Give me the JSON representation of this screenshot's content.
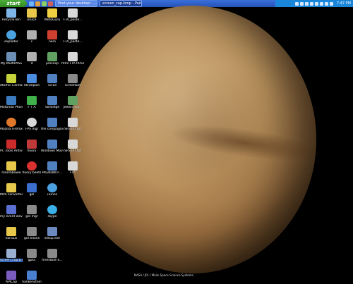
{
  "taskbar": {
    "start_label": "start",
    "tasks": [
      {
        "label": "Post your desktop! -..."
      },
      {
        "label": "screen_cap.bmp - Paint"
      }
    ],
    "clock": "7:47 PM"
  },
  "desktop": {
    "icons": [
      {
        "label": "Recycle Bin",
        "icon": "recycle-bin-icon",
        "color": "#7fb6e8"
      },
      {
        "label": "exploder",
        "icon": "globe-icon",
        "color": "#4aa3e0"
      },
      {
        "label": "My MultiPASS",
        "icon": "computer-icon",
        "color": "#6b8fb5"
      },
      {
        "label": "Atomic Cannon",
        "icon": "hazard-icon",
        "color": "#c6d23a"
      },
      {
        "label": "Motorola Phone Tools",
        "icon": "phone-tools-icon",
        "color": "#3d7bbf"
      },
      {
        "label": "Mozilla Firefox",
        "icon": "firefox-icon",
        "color": "#e0782c"
      },
      {
        "label": "PC Tools Antivirus",
        "icon": "shield-icon",
        "color": "#cc2b2b"
      },
      {
        "label": "mnemboww",
        "icon": "folder-icon",
        "color": "#e8c84a"
      },
      {
        "label": "MP4 converter",
        "icon": "folder-icon",
        "color": "#e8c84a"
      },
      {
        "label": "my event wave",
        "icon": "app-icon",
        "color": "#5a6fcf"
      },
      {
        "label": "various",
        "icon": "folder-icon",
        "color": "#e8c84a"
      },
      {
        "label": "screen_cap.b mp",
        "icon": "image-file-icon",
        "color": "#9ab0d0"
      },
      {
        "label": "APICap",
        "icon": "app-icon",
        "color": "#7a5bbf"
      },
      {
        "label": "bruce",
        "icon": "folder-icon",
        "color": "#e8c84a"
      },
      {
        "label": "c",
        "icon": "drive-icon",
        "color": "#b0b0b0"
      },
      {
        "label": "d",
        "icon": "drive-icon",
        "color": "#b0b0b0"
      },
      {
        "label": "ekranplan",
        "icon": "gear-icon",
        "color": "#4a8de0"
      },
      {
        "label": "F T A",
        "icon": "gear-icon",
        "color": "#3fb04a"
      },
      {
        "label": "FPS mgr",
        "icon": "disc-icon",
        "color": "#d8d8d8"
      },
      {
        "label": "floory",
        "icon": "app-icon",
        "color": "#c03a3a"
      },
      {
        "label": "floory beets",
        "icon": "no-entry-icon",
        "color": "#d93030"
      },
      {
        "label": "gol",
        "icon": "app-icon",
        "color": "#3a6fcf"
      },
      {
        "label": "gol mgr",
        "icon": "app-icon",
        "color": "#8a8a8a"
      },
      {
        "label": "gol tracks",
        "icon": "app-icon",
        "color": "#8a8a8a"
      },
      {
        "label": "gpks",
        "icon": "app-icon",
        "color": "#8a8a8a"
      },
      {
        "label": "hankenstein",
        "icon": "app-icon",
        "color": "#4a7fd0"
      },
      {
        "label": "MotoGuru",
        "icon": "star-icon",
        "color": "#f0d040"
      },
      {
        "label": "nero",
        "icon": "app-icon",
        "color": "#d04030"
      },
      {
        "label": "procexp",
        "icon": "app-icon",
        "color": "#60a060"
      },
      {
        "label": "scrall",
        "icon": "app-icon",
        "color": "#5080c0"
      },
      {
        "label": "Sortilege",
        "icon": "app-icon",
        "color": "#5080c0"
      },
      {
        "label": "the compagnie",
        "icon": "app-icon",
        "color": "#5080c0"
      },
      {
        "label": "Windows Movie Maker",
        "icon": "app-icon",
        "color": "#5080c0"
      },
      {
        "label": "PKENDBOT...",
        "icon": "app-icon",
        "color": "#5080c0"
      },
      {
        "label": "iTunes",
        "icon": "itunes-icon",
        "color": "#4aa0e0"
      },
      {
        "label": "skype",
        "icon": "skype-icon",
        "color": "#3ab0e8"
      },
      {
        "label": "setup.exe",
        "icon": "installer-icon",
        "color": "#6a8ac0"
      },
      {
        "label": "friendbot-S...",
        "icon": "app-icon",
        "color": "#8a8a8a"
      },
      {
        "label": "FTA_poste...",
        "icon": "text-file-icon",
        "color": "#d8d8d8"
      },
      {
        "label": "FTA_poste...",
        "icon": "text-file-icon",
        "color": "#d8d8d8"
      },
      {
        "label": "html FTA POSTER.txt",
        "icon": "text-file-icon",
        "color": "#d8d8d8"
      },
      {
        "label": "screenbot",
        "icon": "app-icon",
        "color": "#8a8a8a"
      },
      {
        "label": "Jewels-Scr...",
        "icon": "app-icon",
        "color": "#60a060"
      },
      {
        "label": "SRSTAT.txt",
        "icon": "text-file-icon",
        "color": "#d8d8d8"
      },
      {
        "label": "SRSTAT.txt",
        "icon": "text-file-icon",
        "color": "#d8d8d8"
      },
      {
        "label": "FTA",
        "icon": "text-file-icon",
        "color": "#d8d8d8"
      }
    ]
  },
  "wallpaper": {
    "credit": "NASA / JPL / Malin Space Science Systems"
  }
}
